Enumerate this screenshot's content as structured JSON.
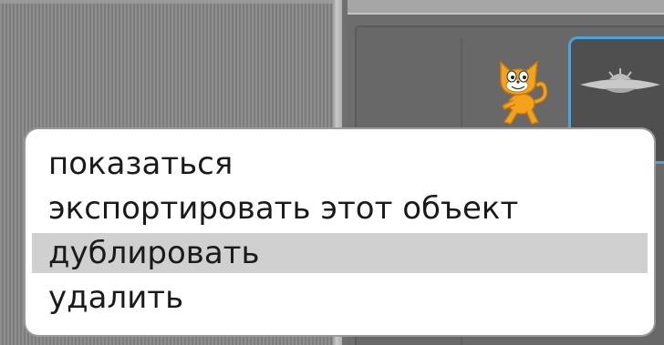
{
  "context_menu": {
    "items": [
      {
        "label": "показаться",
        "highlighted": false
      },
      {
        "label": "экспортировать этот объект",
        "highlighted": false
      },
      {
        "label": "дублировать",
        "highlighted": true
      },
      {
        "label": "удалить",
        "highlighted": false
      }
    ]
  },
  "sprites": [
    {
      "icon": "scratch-cat-sprite-icon",
      "selected": false
    },
    {
      "icon": "saucer-sprite-icon",
      "selected": true
    }
  ],
  "colors": {
    "selection_border": "#4aa3df",
    "menu_highlight": "#d0d0d0",
    "cat_orange": "#f5a21b"
  }
}
